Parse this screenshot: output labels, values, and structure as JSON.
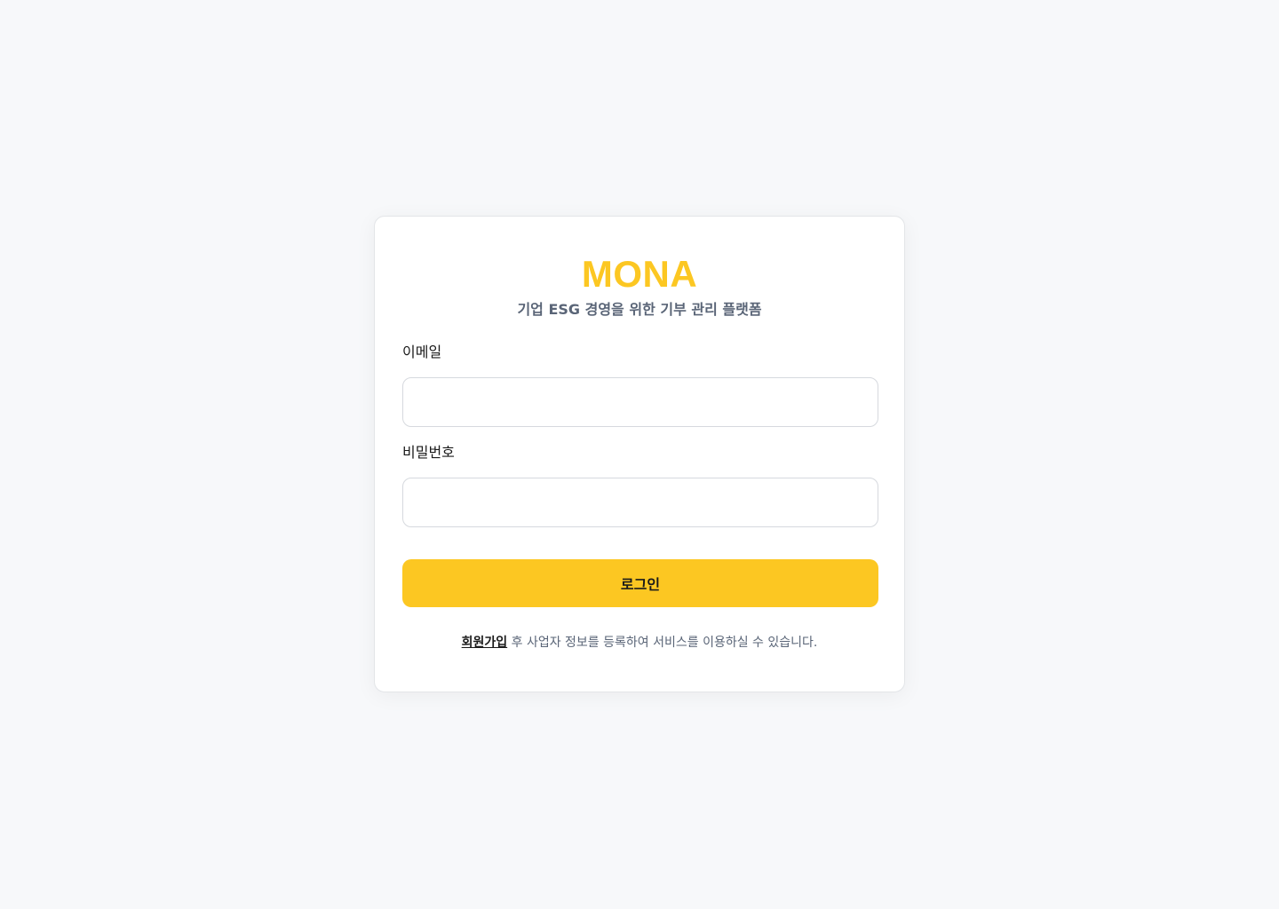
{
  "brand": {
    "name": "MONA",
    "tagline": "기업 ESG 경영을 위한 기부 관리 플랫폼",
    "accent_color": "#fcc722"
  },
  "form": {
    "email_label": "이메일",
    "email_value": "",
    "password_label": "비밀번호",
    "password_value": "",
    "login_label": "로그인"
  },
  "footer": {
    "signup_link": "회원가입",
    "message": " 후 사업자 정보를 등록하여 서비스를 이용하실 수 있습니다."
  }
}
